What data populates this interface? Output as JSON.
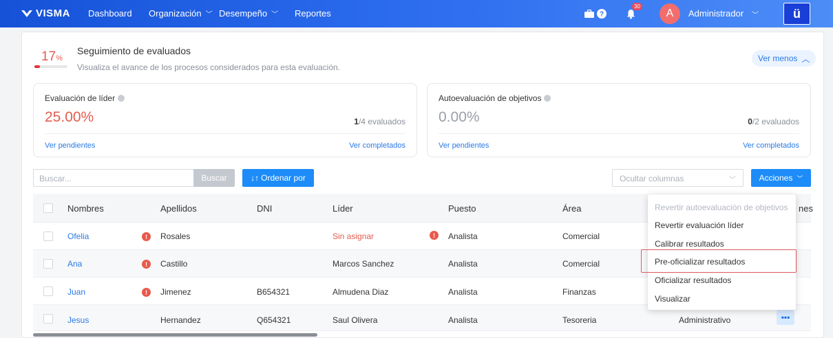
{
  "nav": {
    "logo": "VISMA",
    "items": [
      {
        "label": "Dashboard"
      },
      {
        "label": "Organización",
        "chevron": "chevron-down-icon"
      },
      {
        "label": "Desempeño",
        "chevron": "chevron-down-icon"
      },
      {
        "label": "Reportes"
      }
    ],
    "notification_count": "30",
    "avatar_initial": "A",
    "user_name": "Administrador",
    "app_button": "ü"
  },
  "tracking": {
    "percent": "17",
    "percent_unit": "%",
    "progress_fraction": 0.17,
    "title": "Seguimiento de evaluados",
    "subtitle": "Visualiza el avance de los procesos considerados para esta evaluación.",
    "toggle_label": "Ver menos"
  },
  "cards": [
    {
      "title": "Evaluación de líder",
      "value": "25.00%",
      "value_color": "#e25c4f",
      "count_done": "1",
      "count_rest": "/4 evaluados",
      "link_pending": "Ver pendientes",
      "link_done": "Ver completados"
    },
    {
      "title": "Autoevaluación de objetivos",
      "value": "0.00%",
      "value_color": "#9aa0a8",
      "count_done": "0",
      "count_rest": "/2 evaluados",
      "link_pending": "Ver pendientes",
      "link_done": "Ver completados"
    }
  ],
  "toolbar": {
    "search_placeholder": "Buscar...",
    "search_button": "Buscar",
    "order_button": "Ordenar por",
    "hide_columns_placeholder": "Ocultar columnas",
    "actions_button": "Acciones"
  },
  "table": {
    "columns": [
      "Nombres",
      "Apellidos",
      "DNI",
      "Líder",
      "Puesto",
      "Área"
    ],
    "clipped_column_tail": "nes",
    "rows": [
      {
        "nombre": "Ofelia",
        "apellido": "Rosales",
        "dni": "",
        "lider": "Sin asignar",
        "puesto": "Analista",
        "area": "Comercial"
      },
      {
        "nombre": "Ana",
        "apellido": "Castillo",
        "dni": "",
        "lider": "Marcos Sanchez",
        "puesto": "Analista",
        "area": "Comercial"
      },
      {
        "nombre": "Juan",
        "apellido": "Jimenez",
        "dni": "B654321",
        "lider": "Almudena Diaz",
        "puesto": "Analista",
        "area": "Finanzas"
      },
      {
        "nombre": "Jesus",
        "apellido": "Hernandez",
        "dni": "Q654321",
        "lider": "Saul Olivera",
        "puesto": "Analista",
        "area": "Tesoreria",
        "extra": "Administrativo"
      }
    ]
  },
  "actions_menu": {
    "items": [
      {
        "label": "Revertir autoevaluación de objetivos",
        "disabled": true
      },
      {
        "label": "Revertir evaluación líder"
      },
      {
        "label": "Calibrar resultados"
      },
      {
        "label": "Pre-oficializar resultados",
        "highlighted": true
      },
      {
        "label": "Oficializar resultados"
      },
      {
        "label": "Visualizar"
      }
    ]
  },
  "colors": {
    "brand_blue": "#1d8cf8",
    "danger": "#e25c4f",
    "link": "#2a7ae4"
  }
}
